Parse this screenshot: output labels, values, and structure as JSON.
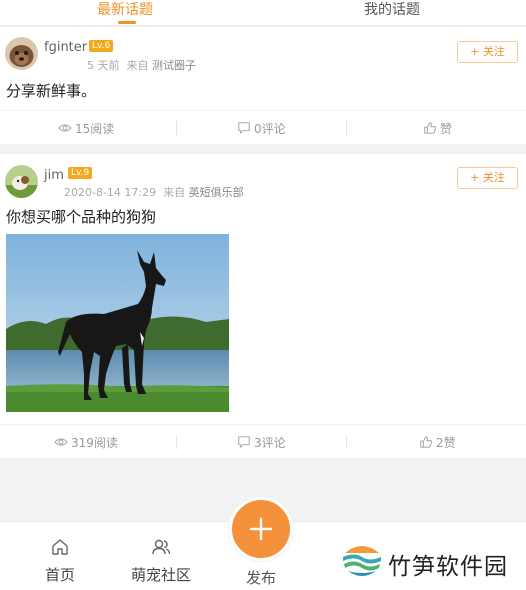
{
  "tabs": {
    "latest": "最新话题",
    "mine": "我的话题",
    "active": "latest"
  },
  "posts": [
    {
      "username": "fginter",
      "level": "Lv.6",
      "time": "5 天前",
      "from_label": "来自",
      "circle": "测试圈子",
      "follow": "+ 关注",
      "text": "分享新鲜事。",
      "views": "15阅读",
      "comments": "0评论",
      "likes": "赞",
      "avatar": "dog-avatar"
    },
    {
      "username": "jim",
      "level": "Lv.9",
      "time": "2020-8-14 17:29",
      "from_label": "来自",
      "circle": "英短俱乐部",
      "follow": "+ 关注",
      "text": "你想买哪个品种的狗狗",
      "image": "great-dane-photo",
      "views": "319阅读",
      "comments": "3评论",
      "likes": "2赞",
      "avatar": "puppy-avatar"
    }
  ],
  "bottom_nav": {
    "home": "首页",
    "pet_community": "萌宠社区",
    "publish": "发布"
  },
  "watermark": {
    "text": "竹笋软件园"
  },
  "colors": {
    "accent": "#f0902c",
    "level_badge": "#f2a91c",
    "fab": "#f4913a"
  }
}
